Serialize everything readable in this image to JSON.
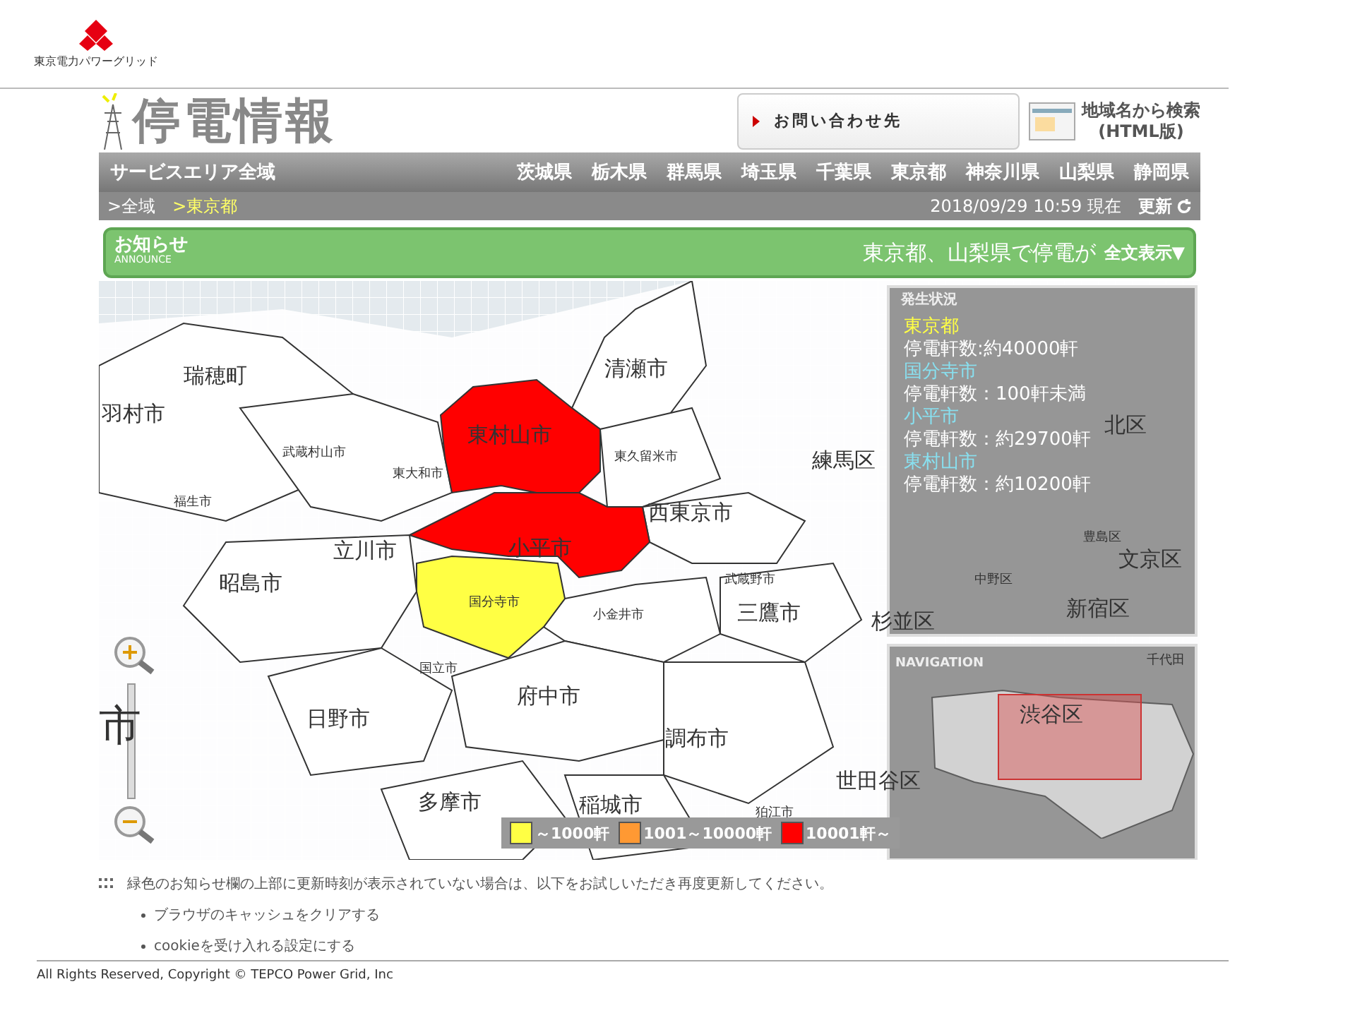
{
  "logo": {
    "caption": "東京電力パワーグリッド"
  },
  "header": {
    "title": "停電情報",
    "contact_button": "お問い合わせ先",
    "search_link": "地域名から検索",
    "search_link_sub": "(HTML版)"
  },
  "nav": {
    "home": "サービスエリア全域",
    "prefectures": [
      "茨城県",
      "栃木県",
      "群馬県",
      "埼玉県",
      "千葉県",
      "東京都",
      "神奈川県",
      "山梨県",
      "静岡県"
    ]
  },
  "breadcrumb": [
    {
      "label": ">全域",
      "current": false
    },
    {
      "label": ">東京都",
      "current": true
    }
  ],
  "timestamp": "2018/09/29 10:59 現在",
  "refresh": "更新",
  "announce": {
    "title": "お知らせ",
    "subtitle": "ANNOUNCE",
    "message": "東京都、山梨県で停電が",
    "toggle": "全文表示▼"
  },
  "map": {
    "areas": [
      {
        "name": "東村山市",
        "color": "#ff0000"
      },
      {
        "name": "小平市",
        "color": "#ff0000"
      },
      {
        "name": "国分寺市",
        "color": "#ffff44"
      }
    ],
    "labels": [
      {
        "name": "瑞穂町",
        "kind": "major"
      },
      {
        "name": "羽村市",
        "kind": "major"
      },
      {
        "name": "清瀬市",
        "kind": "major"
      },
      {
        "name": "武蔵村山市",
        "kind": "minor"
      },
      {
        "name": "東大和市",
        "kind": "minor"
      },
      {
        "name": "東久留米市",
        "kind": "minor"
      },
      {
        "name": "福生市",
        "kind": "minor"
      },
      {
        "name": "練馬区",
        "kind": "major"
      },
      {
        "name": "西東京市",
        "kind": "major"
      },
      {
        "name": "立川市",
        "kind": "major"
      },
      {
        "name": "昭島市",
        "kind": "major"
      },
      {
        "name": "武蔵野市",
        "kind": "minor"
      },
      {
        "name": "小金井市",
        "kind": "minor"
      },
      {
        "name": "杉並区",
        "kind": "major"
      },
      {
        "name": "三鷹市",
        "kind": "major"
      },
      {
        "name": "国立市",
        "kind": "minor"
      },
      {
        "name": "府中市",
        "kind": "major"
      },
      {
        "name": "市",
        "kind": "huge"
      },
      {
        "name": "日野市",
        "kind": "major"
      },
      {
        "name": "調布市",
        "kind": "major"
      },
      {
        "name": "多摩市",
        "kind": "major"
      },
      {
        "name": "稲城市",
        "kind": "major"
      },
      {
        "name": "狛江市",
        "kind": "minor"
      },
      {
        "name": "世田谷区",
        "kind": "major"
      },
      {
        "name": "北区",
        "kind": "major"
      },
      {
        "name": "豊島区",
        "kind": "minor"
      },
      {
        "name": "中野区",
        "kind": "minor"
      },
      {
        "name": "文京区",
        "kind": "major"
      },
      {
        "name": "新宿区",
        "kind": "major"
      },
      {
        "name": "千代田",
        "kind": "minor"
      },
      {
        "name": "渋谷区",
        "kind": "major"
      }
    ]
  },
  "status_panel": {
    "title": "発生状況",
    "entries": [
      {
        "area": "東京都",
        "kind": "prefecture",
        "count": "停電軒数:約40000軒"
      },
      {
        "area": "国分寺市",
        "kind": "city",
        "count": "停電軒数：100軒未満"
      },
      {
        "area": "小平市",
        "kind": "city",
        "count": "停電軒数：約29700軒"
      },
      {
        "area": "東村山市",
        "kind": "city",
        "count": "停電軒数：約10200軒"
      }
    ]
  },
  "navigation": {
    "title": "NAVIGATION"
  },
  "legend": [
    {
      "label": "～1000軒",
      "color": "#ffff44"
    },
    {
      "label": "1001～10000軒",
      "color": "#ff9933"
    },
    {
      "label": "10001軒～",
      "color": "#ff0000"
    }
  ],
  "notice": {
    "text": "緑色のお知らせ欄の上部に更新時刻が表示されていない場合は、以下をお試しいただき再度更新してください。",
    "bullets": [
      "ブラウザのキャッシュをクリアする",
      "cookieを受け入れる設定にする"
    ]
  },
  "copyright": "All Rights Reserved, Copyright © TEPCO Power Grid, Inc"
}
